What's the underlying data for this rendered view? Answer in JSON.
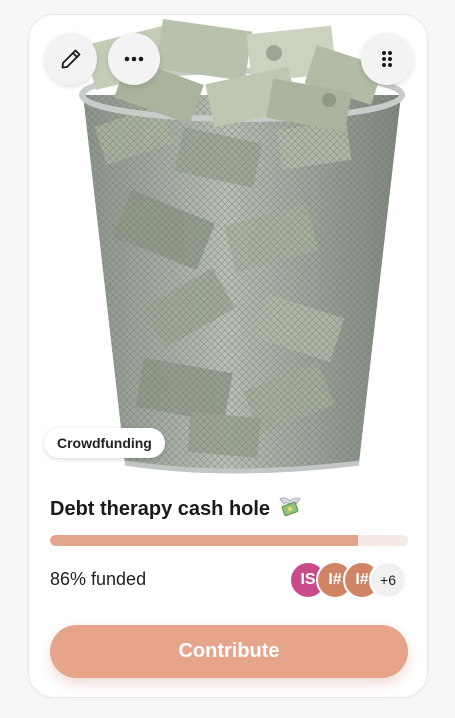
{
  "card": {
    "tag": "Crowdfunding",
    "title": "Debt therapy cash hole",
    "title_emoji": "money-with-wings-icon",
    "progress_percent": 86,
    "funded_label": "86% funded",
    "contributors": [
      {
        "initials": "IS",
        "color": "#c94b8a"
      },
      {
        "initials": "I#",
        "color": "#d08466"
      },
      {
        "initials": "I#",
        "color": "#d08466"
      }
    ],
    "more_count": "+6",
    "contribute_label": "Contribute"
  },
  "toolbar": {
    "edit_icon": "pencil-icon",
    "more_icon": "ellipsis-icon",
    "drag_icon": "drag-handle-icon"
  },
  "colors": {
    "accent": "#e6a48b",
    "progress_track": "#f7e9e4"
  }
}
